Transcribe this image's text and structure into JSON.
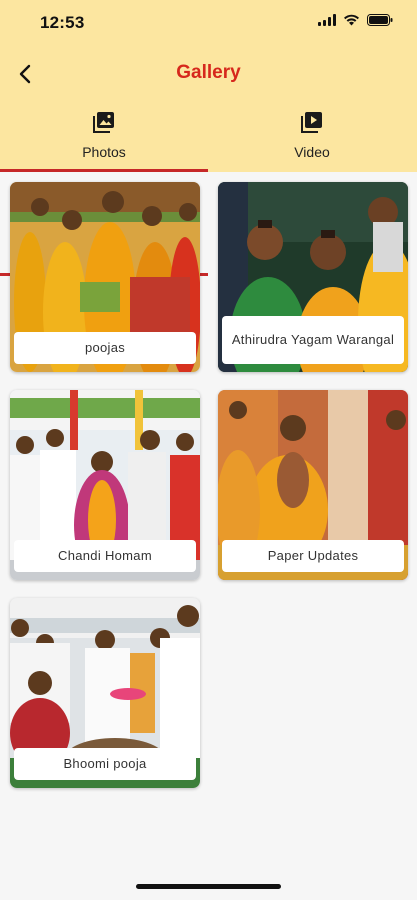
{
  "status_bar": {
    "time": "12:53",
    "icons": [
      "signal-icon",
      "wifi-icon",
      "battery-icon"
    ]
  },
  "header": {
    "title": "Gallery",
    "back_icon": "chevron-left-icon",
    "colors": {
      "background": "#fce6a0",
      "title": "#d6281c",
      "accent": "#c62828"
    }
  },
  "tabs": [
    {
      "label": "Photos",
      "icon": "photos-icon",
      "selected": true
    },
    {
      "label": "Video",
      "icon": "video-icon",
      "selected": false
    }
  ],
  "gallery": [
    {
      "caption": "poojas"
    },
    {
      "caption": "Athirudra Yagam Warangal"
    },
    {
      "caption": "Chandi Homam"
    },
    {
      "caption": "Paper Updates"
    },
    {
      "caption": "Bhoomi pooja"
    }
  ]
}
